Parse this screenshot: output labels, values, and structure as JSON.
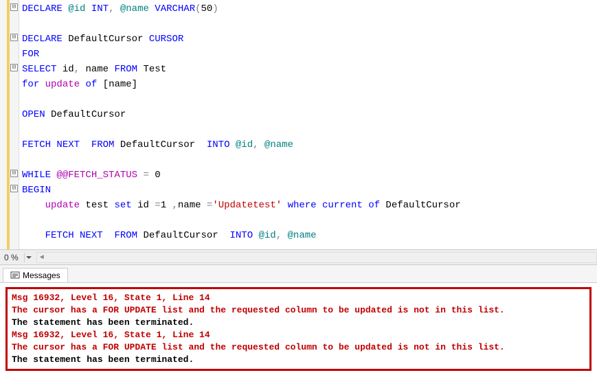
{
  "code": {
    "lines": [
      {
        "tokens": [
          [
            "kw",
            "DECLARE"
          ],
          [
            "txt",
            " "
          ],
          [
            "va",
            "@id"
          ],
          [
            "txt",
            " "
          ],
          [
            "type",
            "INT"
          ],
          [
            "op",
            ","
          ],
          [
            "txt",
            " "
          ],
          [
            "va",
            "@name"
          ],
          [
            "txt",
            " "
          ],
          [
            "type",
            "VARCHAR"
          ],
          [
            "op",
            "("
          ],
          [
            "num",
            "50"
          ],
          [
            "op",
            ")"
          ]
        ]
      },
      {
        "tokens": []
      },
      {
        "tokens": [
          [
            "kw",
            "DECLARE"
          ],
          [
            "txt",
            " DefaultCursor "
          ],
          [
            "kw",
            "CURSOR"
          ]
        ]
      },
      {
        "tokens": [
          [
            "kw",
            "FOR"
          ]
        ]
      },
      {
        "tokens": [
          [
            "kw",
            "SELECT"
          ],
          [
            "txt",
            " id"
          ],
          [
            "op",
            ","
          ],
          [
            "txt",
            " name "
          ],
          [
            "kw",
            "FROM"
          ],
          [
            "txt",
            " Test"
          ]
        ]
      },
      {
        "tokens": [
          [
            "kw",
            "for"
          ],
          [
            "txt",
            " "
          ],
          [
            "func",
            "update"
          ],
          [
            "txt",
            " "
          ],
          [
            "kw",
            "of"
          ],
          [
            "txt",
            " [name]"
          ]
        ]
      },
      {
        "tokens": []
      },
      {
        "tokens": [
          [
            "kw",
            "OPEN"
          ],
          [
            "txt",
            " DefaultCursor"
          ]
        ]
      },
      {
        "tokens": []
      },
      {
        "tokens": [
          [
            "kw",
            "FETCH"
          ],
          [
            "txt",
            " "
          ],
          [
            "kw",
            "NEXT"
          ],
          [
            "txt",
            "  "
          ],
          [
            "kw",
            "FROM"
          ],
          [
            "txt",
            " DefaultCursor  "
          ],
          [
            "kw",
            "INTO"
          ],
          [
            "txt",
            " "
          ],
          [
            "va",
            "@id"
          ],
          [
            "op",
            ","
          ],
          [
            "txt",
            " "
          ],
          [
            "va",
            "@name"
          ]
        ]
      },
      {
        "tokens": []
      },
      {
        "tokens": [
          [
            "kw",
            "WHILE"
          ],
          [
            "txt",
            " "
          ],
          [
            "func",
            "@@FETCH_STATUS"
          ],
          [
            "txt",
            " "
          ],
          [
            "op",
            "="
          ],
          [
            "txt",
            " 0"
          ]
        ]
      },
      {
        "tokens": [
          [
            "kw",
            "BEGIN"
          ]
        ]
      },
      {
        "tokens": [
          [
            "txt",
            "    "
          ],
          [
            "func",
            "update"
          ],
          [
            "txt",
            " test "
          ],
          [
            "kw",
            "set"
          ],
          [
            "txt",
            " id "
          ],
          [
            "op",
            "="
          ],
          [
            "num",
            "1"
          ],
          [
            "txt",
            " "
          ],
          [
            "op",
            ","
          ],
          [
            "txt",
            "name "
          ],
          [
            "op",
            "="
          ],
          [
            "str",
            "'Updatetest'"
          ],
          [
            "txt",
            " "
          ],
          [
            "kw",
            "where"
          ],
          [
            "txt",
            " "
          ],
          [
            "kw",
            "current"
          ],
          [
            "txt",
            " "
          ],
          [
            "kw",
            "of"
          ],
          [
            "txt",
            " DefaultCursor"
          ]
        ]
      },
      {
        "tokens": []
      },
      {
        "tokens": [
          [
            "txt",
            "    "
          ],
          [
            "kw",
            "FETCH"
          ],
          [
            "txt",
            " "
          ],
          [
            "kw",
            "NEXT"
          ],
          [
            "txt",
            "  "
          ],
          [
            "kw",
            "FROM"
          ],
          [
            "txt",
            " DefaultCursor  "
          ],
          [
            "kw",
            "INTO"
          ],
          [
            "txt",
            " "
          ],
          [
            "va",
            "@id"
          ],
          [
            "op",
            ","
          ],
          [
            "txt",
            " "
          ],
          [
            "va",
            "@name"
          ]
        ]
      }
    ]
  },
  "zoom": {
    "value": "0 %"
  },
  "tab": {
    "label": "Messages"
  },
  "messages": {
    "lines": [
      {
        "cls": "msg-red",
        "text": "Msg 16932, Level 16, State 1, Line 14"
      },
      {
        "cls": "msg-red",
        "text": "The cursor has a FOR UPDATE list and the requested column to be updated is not in this list."
      },
      {
        "cls": "msg-black",
        "text": "The statement has been terminated."
      },
      {
        "cls": "msg-red",
        "text": "Msg 16932, Level 16, State 1, Line 14"
      },
      {
        "cls": "msg-red",
        "text": "The cursor has a FOR UPDATE list and the requested column to be updated is not in this list."
      },
      {
        "cls": "msg-black",
        "text": "The statement has been terminated."
      }
    ]
  },
  "fold_glyph": "⊟"
}
